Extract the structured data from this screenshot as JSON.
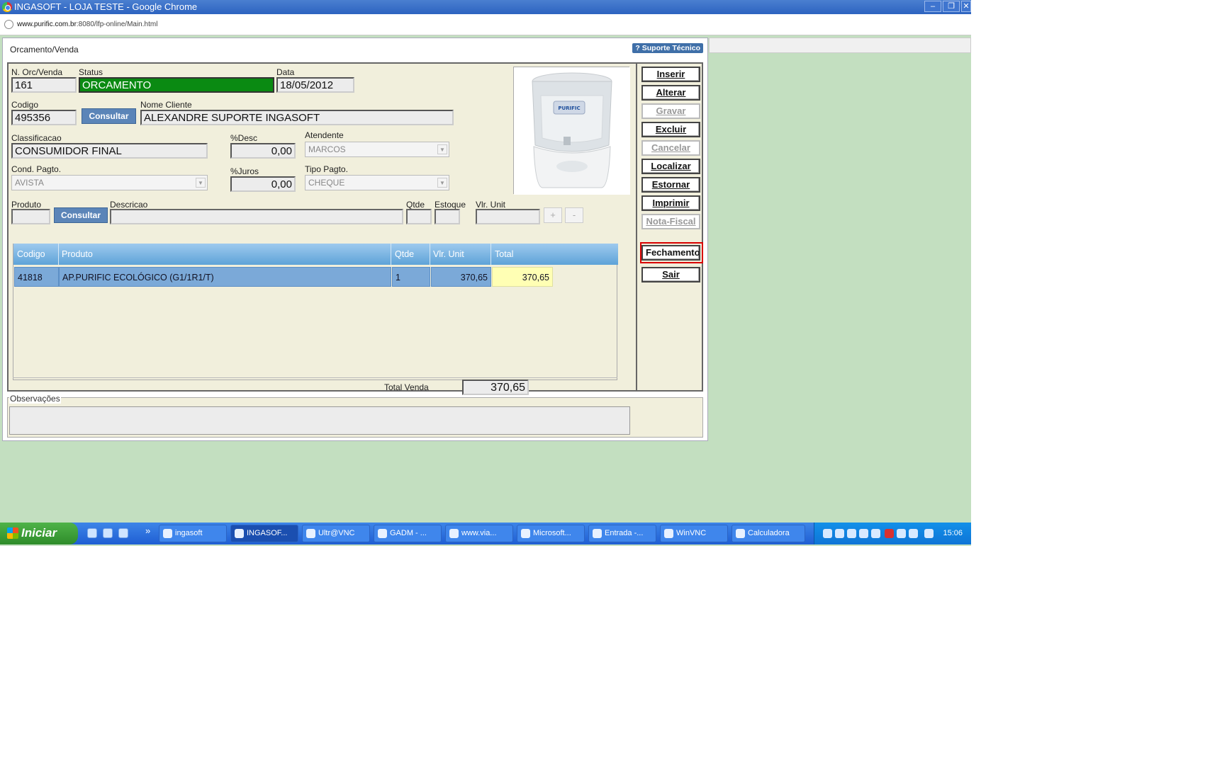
{
  "browser": {
    "title": "INGASOFT - LOJA TESTE - Google Chrome",
    "url_host": "www.purific.com.br",
    "url_path": ":8080/lfp-online/Main.html",
    "window_buttons": [
      "–",
      "❐",
      "✕"
    ]
  },
  "app": {
    "title": "Orcamento/Venda",
    "support_button": "? Suporte Técnico"
  },
  "form": {
    "order_no_label": "N. Orc/Venda",
    "order_no": "161",
    "status_label": "Status",
    "status": "ORCAMENTO",
    "date_label": "Data",
    "date": "18/05/2012",
    "code_label": "Codigo",
    "code": "495356",
    "consult_client": "Consultar",
    "client_name_label": "Nome Cliente",
    "client_name": "ALEXANDRE SUPORTE INGASOFT",
    "classification_label": "Classificacao",
    "classification": "CONSUMIDOR FINAL",
    "discount_label": "%Desc",
    "discount": "0,00",
    "attendant_label": "Atendente",
    "attendant": "MARCOS",
    "payment_cond_label": "Cond. Pagto.",
    "payment_cond": "AVISTA",
    "interest_label": "%Juros",
    "interest": "0,00",
    "payment_type_label": "Tipo Pagto.",
    "payment_type": "CHEQUE",
    "product_label": "Produto",
    "consult_product": "Consultar",
    "description_label": "Descricao",
    "qty_label": "Qtde",
    "stock_label": "Estoque",
    "unit_price_label": "Vlr. Unit",
    "plus": "+",
    "minus": "-"
  },
  "product_image": {
    "brand": "PURIFIC"
  },
  "grid": {
    "headers": [
      "Codigo",
      "Produto",
      "Qtde",
      "Vlr. Unit",
      "Total"
    ],
    "rows": [
      {
        "codigo": "41818",
        "produto": "AP.PURIFIC ECOLÓGICO (G1/1R1/T)",
        "qtde": "1",
        "vlr_unit": "370,65",
        "total": "370,65"
      }
    ]
  },
  "totals": {
    "label": "Total Venda",
    "value": "370,65"
  },
  "actions": {
    "inserir": "Inserir",
    "alterar": "Alterar",
    "gravar": "Gravar",
    "excluir": "Excluir",
    "cancelar": "Cancelar",
    "localizar": "Localizar",
    "estornar": "Estornar",
    "imprimir": "Imprimir",
    "nota_fiscal": "Nota-Fiscal",
    "fechamento": "Fechamento",
    "sair": "Sair"
  },
  "observations": {
    "label": "Observações"
  },
  "taskbar": {
    "start": "Iniciar",
    "more": "»",
    "items": [
      "ingasoft",
      "INGASOF...",
      "Ultr@VNC",
      "GADM - ...",
      "www.via...",
      "Microsoft...",
      "Entrada -...",
      "WinVNC",
      "Calculadora"
    ],
    "clock": "15:06"
  },
  "colors": {
    "desktop_bg": "#c3dfc0",
    "status_green": "#0a8a12",
    "grid_header": "#5ea3d8",
    "selected_row": "#7ba9d8",
    "total_cell": "#ffffb4",
    "highlight": "#d80000"
  }
}
